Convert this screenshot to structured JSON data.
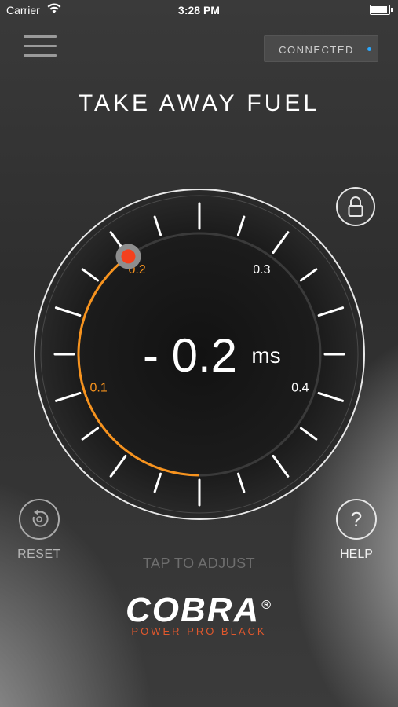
{
  "status_bar": {
    "carrier": "Carrier",
    "time": "3:28 PM"
  },
  "header": {
    "connection_status": "CONNECTED"
  },
  "page": {
    "title": "TAKE AWAY FUEL"
  },
  "dial": {
    "value_text": "- 0.2",
    "unit": "ms",
    "tick_labels": [
      "0.1",
      "0.2",
      "0.3",
      "0.4"
    ],
    "accent_color": "#f7931e",
    "indicator_color": "#f4411e",
    "scale_min": 0.0,
    "scale_max": 0.5,
    "current_value": 0.2
  },
  "actions": {
    "reset_label": "RESET",
    "help_label": "HELP",
    "help_glyph": "?",
    "tap_hint": "TAP TO ADJUST"
  },
  "brand": {
    "name": "COBRA",
    "reg_mark": "®",
    "product": "POWER PRO BLACK",
    "product_color": "#e0582d"
  }
}
